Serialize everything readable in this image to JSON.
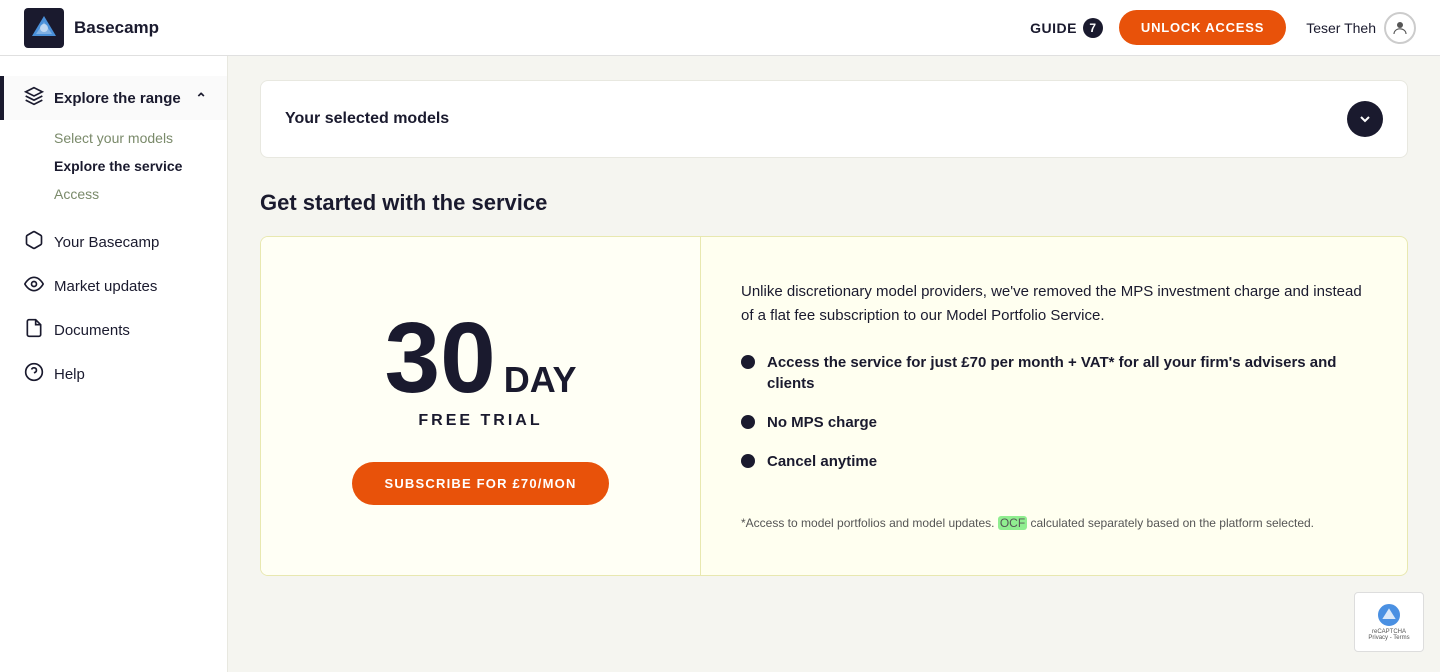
{
  "topnav": {
    "logo_alt": "Invesco",
    "title": "Basecamp",
    "guide_label": "GUIDE",
    "guide_number": "7",
    "unlock_label": "UNLOCK ACCESS",
    "user_name": "Teser Theh"
  },
  "sidebar": {
    "explore_range_label": "Explore the range",
    "explore_range_icon": "layers",
    "sub_items": [
      {
        "label": "Select your models",
        "active": false
      },
      {
        "label": "Explore the service",
        "active": true
      },
      {
        "label": "Access",
        "active": false
      }
    ],
    "nav_items": [
      {
        "label": "Your Basecamp",
        "icon": "box"
      },
      {
        "label": "Market updates",
        "icon": "eye"
      },
      {
        "label": "Documents",
        "icon": "file"
      },
      {
        "label": "Help",
        "icon": "help-circle"
      }
    ]
  },
  "selected_models": {
    "title": "Your selected models"
  },
  "get_started": {
    "title": "Get started with the service",
    "trial_number": "30",
    "trial_day": "DAY",
    "trial_label": "FREE TRIAL",
    "subscribe_label": "SUBSCRIBE FOR £70/MON",
    "description": "Unlike discretionary model providers, we've removed the MPS investment charge and instead of a flat fee subscription to our Model Portfolio Service.",
    "bullets": [
      "Access the service for just £70 per month + VAT* for all your firm's advisers and clients",
      "No MPS charge",
      "Cancel anytime"
    ],
    "footnote_pre": "*Access to model portfolios and model updates. ",
    "footnote_ocf": "OCF",
    "footnote_post": " calculated separately based on the platform selected."
  }
}
